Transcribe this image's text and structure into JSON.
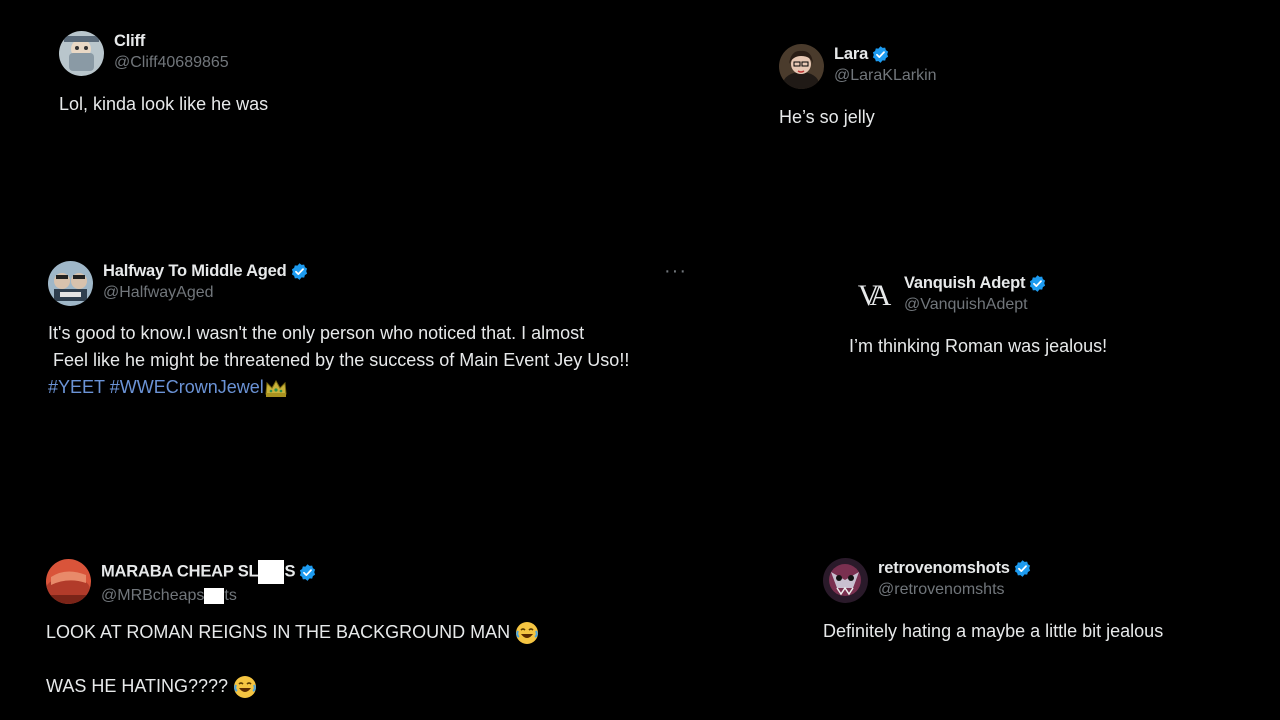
{
  "tweets": [
    {
      "name": "Cliff",
      "handle": "@Cliff40689865",
      "text": "Lol, kinda look like he was"
    },
    {
      "name": "Lara",
      "handle": "@LaraKLarkin",
      "text": "He’s so jelly"
    },
    {
      "name": "Halfway To Middle Aged",
      "handle": "@HalfwayAged",
      "line1": "It's good to know.I wasn't the only person who noticed that. I almost",
      "line2": " Feel like he might be threatened by the success of Main Event Jey Uso!!",
      "hashtag1": "#YEET",
      "hashtag2": "#WWECrownJewel",
      "more_label": "···"
    },
    {
      "name": "Vanquish Adept",
      "handle": "@VanquishAdept",
      "avatar_text": "VA",
      "text": "I’m thinking Roman was jealous!"
    },
    {
      "name_a": "MARABA CHEAP SL",
      "name_b": "S",
      "handle_a": "@MRBcheaps",
      "handle_b": "ts",
      "line1": "LOOK AT ROMAN REIGNS IN THE BACKGROUND MAN",
      "line2": "WAS HE HATING????"
    },
    {
      "name": "retrovenomshots",
      "handle": "@retrovenomshts",
      "text": "Definitely hating a maybe a little bit jealous"
    }
  ],
  "colors": {
    "background": "#000000",
    "text": "#e7e9ea",
    "muted": "#71767b",
    "verified": "#1d9bf0",
    "hashtag": "#6b93d6"
  },
  "icons": [
    "verified-badge-icon",
    "more-icon",
    "crown-emoji-icon",
    "laughing-emoji-icon"
  ]
}
